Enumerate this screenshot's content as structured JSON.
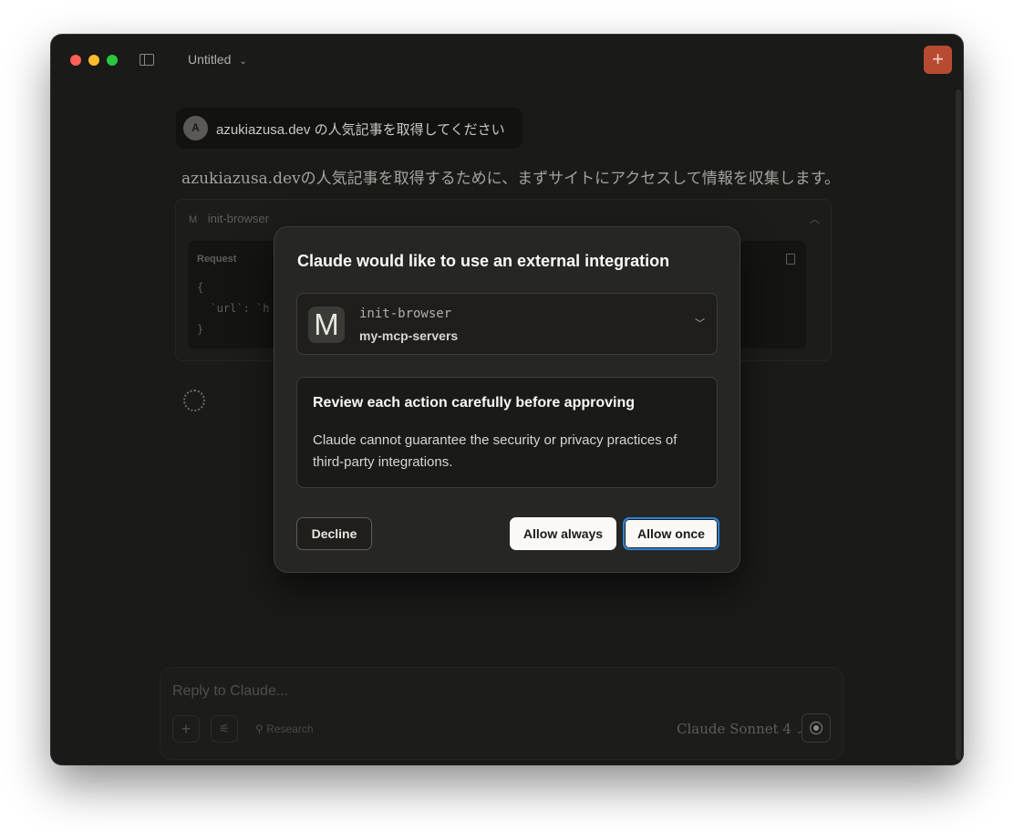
{
  "window": {
    "title": "Untitled",
    "title_chevron": "⌄",
    "new_chat_icon": "+"
  },
  "conversation": {
    "user_avatar": "A",
    "user_message": "azukiazusa.dev の人気記事を取得してください",
    "assistant_message": "azukiazusa.devの人気記事を取得するために、まずサイトにアクセスして情報を収集します。",
    "tool_call": {
      "icon_letter": "M",
      "name": "init-browser",
      "request_label": "Request",
      "code_lines": [
        "{",
        "  `url`: `h",
        "}"
      ]
    }
  },
  "composer": {
    "placeholder": "Reply to Claude...",
    "add_icon": "+",
    "tools_icon": "⚟",
    "research_label": "Research",
    "model_label": "Claude Sonnet 4"
  },
  "modal": {
    "title": "Claude would like to use an external integration",
    "integration": {
      "logo_letter": "M",
      "tool_name": "init-browser",
      "server_name": "my-mcp-servers"
    },
    "warning": {
      "title": "Review each action carefully before approving",
      "body": "Claude cannot guarantee the security or privacy practices of third-party integrations."
    },
    "buttons": {
      "decline": "Decline",
      "allow_always": "Allow always",
      "allow_once": "Allow once"
    }
  },
  "colors": {
    "window_bg": "#1a1a19",
    "modal_bg": "#262624",
    "accent": "#b84a32",
    "focus_ring": "#2c84db"
  }
}
